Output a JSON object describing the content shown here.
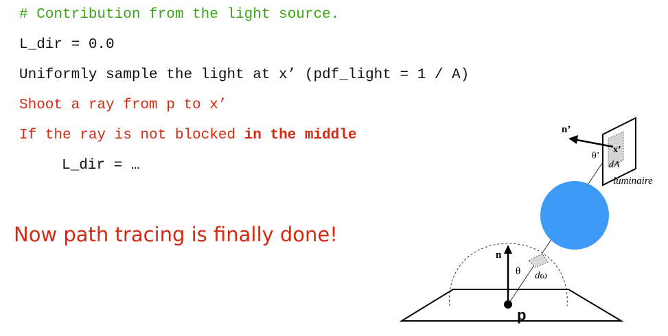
{
  "code": {
    "comment": "# Contribution from the light source.",
    "init": "L_dir = 0.0",
    "sample": "Uniformly sample the light at x’ (pdf_light = 1 / A)",
    "shoot": "Shoot a ray from p to x’",
    "if_prefix": "If the ray is not blocked ",
    "if_bold": "in the middle",
    "assign": "L_dir = …"
  },
  "headline": "Now path tracing is finally done!",
  "diagram": {
    "n_prime": "n’",
    "theta_prime": "θ’",
    "x_prime": "x’",
    "dA": "dA",
    "luminaire": "luminaire",
    "n": "n",
    "theta": "θ",
    "d_omega": "dω",
    "p": "p"
  },
  "colors": {
    "comment": "#3aa415",
    "highlight": "#d42a12",
    "occluder": "#3d9bf7"
  }
}
